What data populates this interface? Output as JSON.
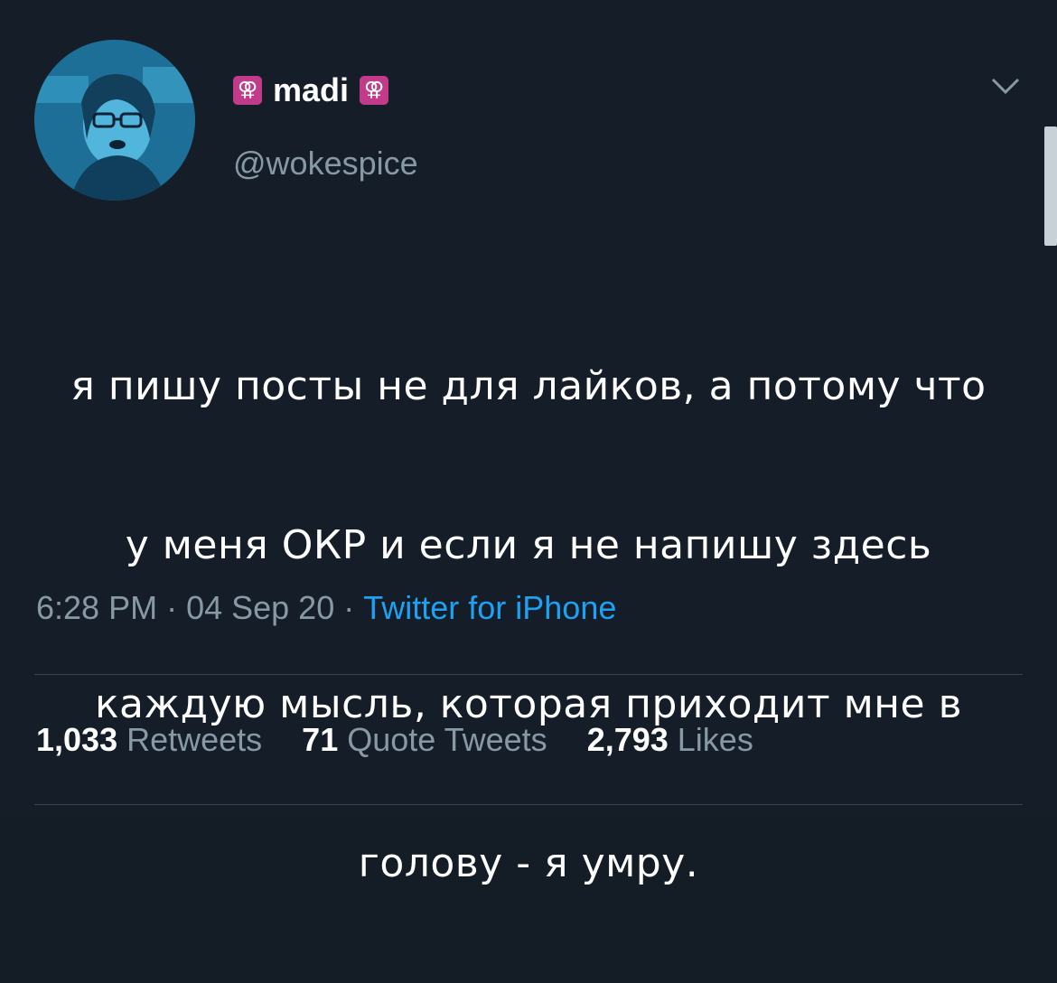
{
  "user": {
    "display_name": "madi",
    "emoji": "⚢",
    "handle": "@wokespice"
  },
  "tweet": {
    "text_lines": [
      "я пишу посты не для лайков, а потому что",
      "у меня ОКР и если я не напишу здесь",
      "каждую мысль, которая приходит мне в",
      "голову - я умру."
    ]
  },
  "meta": {
    "time": "6:28 PM",
    "date": "04 Sep 20",
    "separator": "·",
    "source": "Twitter for iPhone"
  },
  "stats": {
    "retweets_count": "1,033",
    "retweets_label": "Retweets",
    "quotes_count": "71",
    "quotes_label": "Quote Tweets",
    "likes_count": "2,793",
    "likes_label": "Likes"
  },
  "colors": {
    "background": "#151e28",
    "muted_text": "#8899a6",
    "link": "#1da1f2",
    "divider": "#38444d"
  }
}
